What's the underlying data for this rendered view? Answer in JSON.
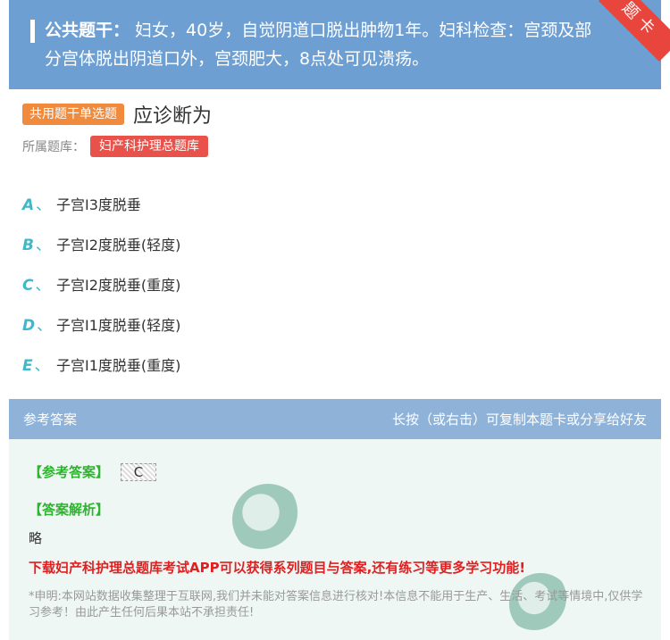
{
  "stem": {
    "label": "公共题干：",
    "text": "妇女，40岁，自觉阴道口脱出肿物1年。妇科检查：宫颈及部分宫体脱出阴道口外，宫颈肥大，8点处可见溃疡。"
  },
  "ribbon": "题卡",
  "question": {
    "type_badge": "共用题干单选题",
    "title": "应诊断为"
  },
  "bank": {
    "label": "所属题库：",
    "name": "妇产科护理总题库"
  },
  "options": [
    {
      "letter": "A",
      "text": "子宫I3度脱垂"
    },
    {
      "letter": "B",
      "text": "子宫I2度脱垂(轻度)"
    },
    {
      "letter": "C",
      "text": "子宫I2度脱垂(重度)"
    },
    {
      "letter": "D",
      "text": "子宫I1度脱垂(轻度)"
    },
    {
      "letter": "E",
      "text": "子宫I1度脱垂(重度)"
    }
  ],
  "answer_section": {
    "header_left": "参考答案",
    "header_right": "长按（或右击）可复制本题卡或分享给好友",
    "answer_label": "【参考答案】",
    "answer_value": "C",
    "analysis_label": "【答案解析】",
    "analysis_text": "略",
    "promo": "下载妇产科护理总题库考试APP可以获得系列题目与答案,还有练习等更多学习功能!",
    "disclaimer": "*申明:本网站数据收集整理于互联网,我们并未能对答案信息进行核对!本信息不能用于生产、生活、考试等情境中,仅供学习参考！由此产生任何后果本站不承担责任!"
  },
  "colors": {
    "stem_bg": "#6e9fd3",
    "ribbon": "#e8453c",
    "type_badge": "#f08a3c",
    "bank_tag": "#e8524a",
    "option_letter": "#3fb8c9",
    "answer_header": "#8fb3d8",
    "answer_bg": "#eef7f4",
    "answer_key": "#2bb52b",
    "promo": "#e02020"
  }
}
